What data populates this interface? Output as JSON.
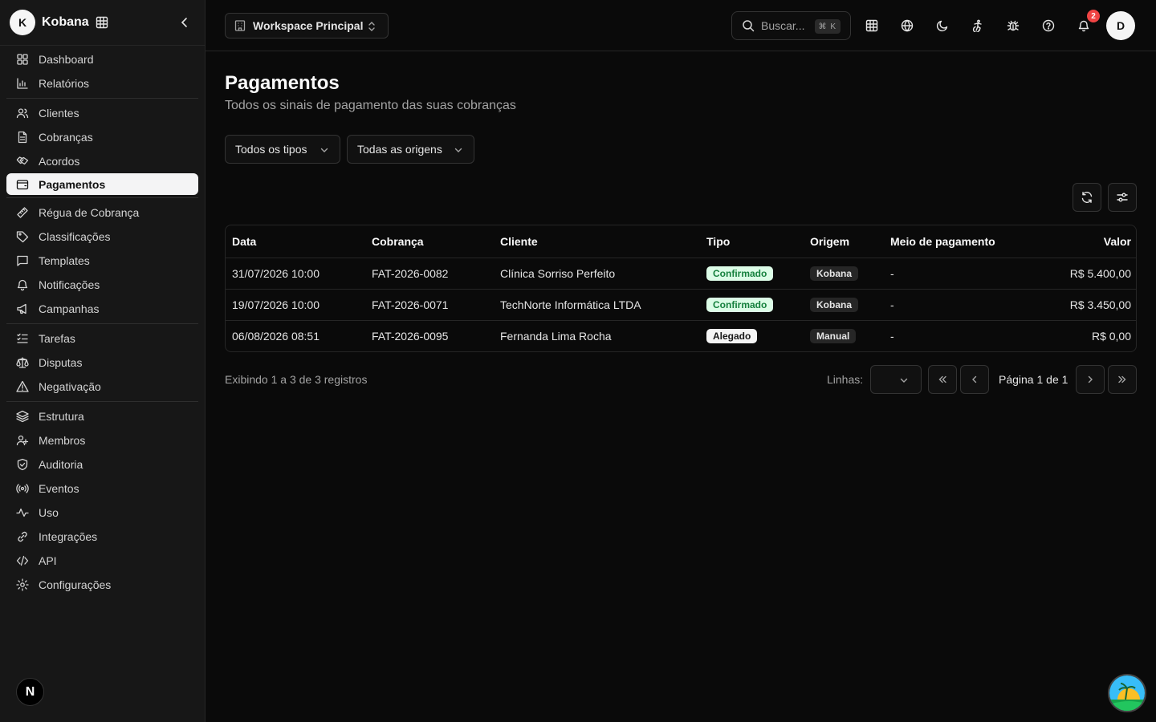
{
  "brand": {
    "initial": "K",
    "name": "Kobana"
  },
  "sidebar": {
    "groups": [
      [
        {
          "label": "Dashboard",
          "icon": "dashboard-icon"
        },
        {
          "label": "Relatórios",
          "icon": "chart-icon"
        }
      ],
      [
        {
          "label": "Clientes",
          "icon": "users-icon"
        },
        {
          "label": "Cobranças",
          "icon": "document-icon"
        },
        {
          "label": "Acordos",
          "icon": "handshake-icon"
        },
        {
          "label": "Pagamentos",
          "icon": "wallet-icon",
          "active": true
        }
      ],
      [
        {
          "label": "Régua de Cobrança",
          "icon": "ruler-icon"
        },
        {
          "label": "Classificações",
          "icon": "tag-icon"
        },
        {
          "label": "Templates",
          "icon": "message-icon"
        },
        {
          "label": "Notificações",
          "icon": "bell-icon"
        },
        {
          "label": "Campanhas",
          "icon": "megaphone-icon"
        }
      ],
      [
        {
          "label": "Tarefas",
          "icon": "list-check-icon"
        },
        {
          "label": "Disputas",
          "icon": "scale-icon"
        },
        {
          "label": "Negativação",
          "icon": "warning-icon"
        }
      ],
      [
        {
          "label": "Estrutura",
          "icon": "layers-icon"
        },
        {
          "label": "Membros",
          "icon": "members-icon"
        },
        {
          "label": "Auditoria",
          "icon": "shield-icon"
        },
        {
          "label": "Eventos",
          "icon": "radio-icon"
        },
        {
          "label": "Uso",
          "icon": "activity-icon"
        },
        {
          "label": "Integrações",
          "icon": "link-icon"
        },
        {
          "label": "API",
          "icon": "code-icon"
        },
        {
          "label": "Configurações",
          "icon": "gear-icon"
        }
      ]
    ],
    "footer_badge": "N"
  },
  "topbar": {
    "workspace": "Workspace Principal",
    "search_placeholder": "Buscar...",
    "search_shortcut": "⌘ K",
    "notification_count": "2",
    "user_initial": "D"
  },
  "main": {
    "title": "Pagamentos",
    "subtitle": "Todos os sinais de pagamento das suas cobranças",
    "filters": {
      "types": "Todos os tipos",
      "origins": "Todas as origens"
    }
  },
  "table": {
    "columns": [
      "Data",
      "Cobrança",
      "Cliente",
      "Tipo",
      "Origem",
      "Meio de pagamento",
      "Valor"
    ],
    "rows": [
      {
        "date": "31/07/2026 10:00",
        "charge": "FAT-2026-0082",
        "client": "Clínica Sorriso Perfeito",
        "type": "Confirmado",
        "origin": "Kobana",
        "method": "-",
        "value": "R$ 5.400,00"
      },
      {
        "date": "19/07/2026 10:00",
        "charge": "FAT-2026-0071",
        "client": "TechNorte Informática LTDA",
        "type": "Confirmado",
        "origin": "Kobana",
        "method": "-",
        "value": "R$ 3.450,00"
      },
      {
        "date": "06/08/2026 08:51",
        "charge": "FAT-2026-0095",
        "client": "Fernanda Lima Rocha",
        "type": "Alegado",
        "origin": "Manual",
        "method": "-",
        "value": "R$ 0,00"
      }
    ]
  },
  "pagination": {
    "summary": "Exibindo 1 a 3 de 3 registros",
    "rows_label": "Linhas:",
    "page_info": "Página 1 de 1"
  }
}
